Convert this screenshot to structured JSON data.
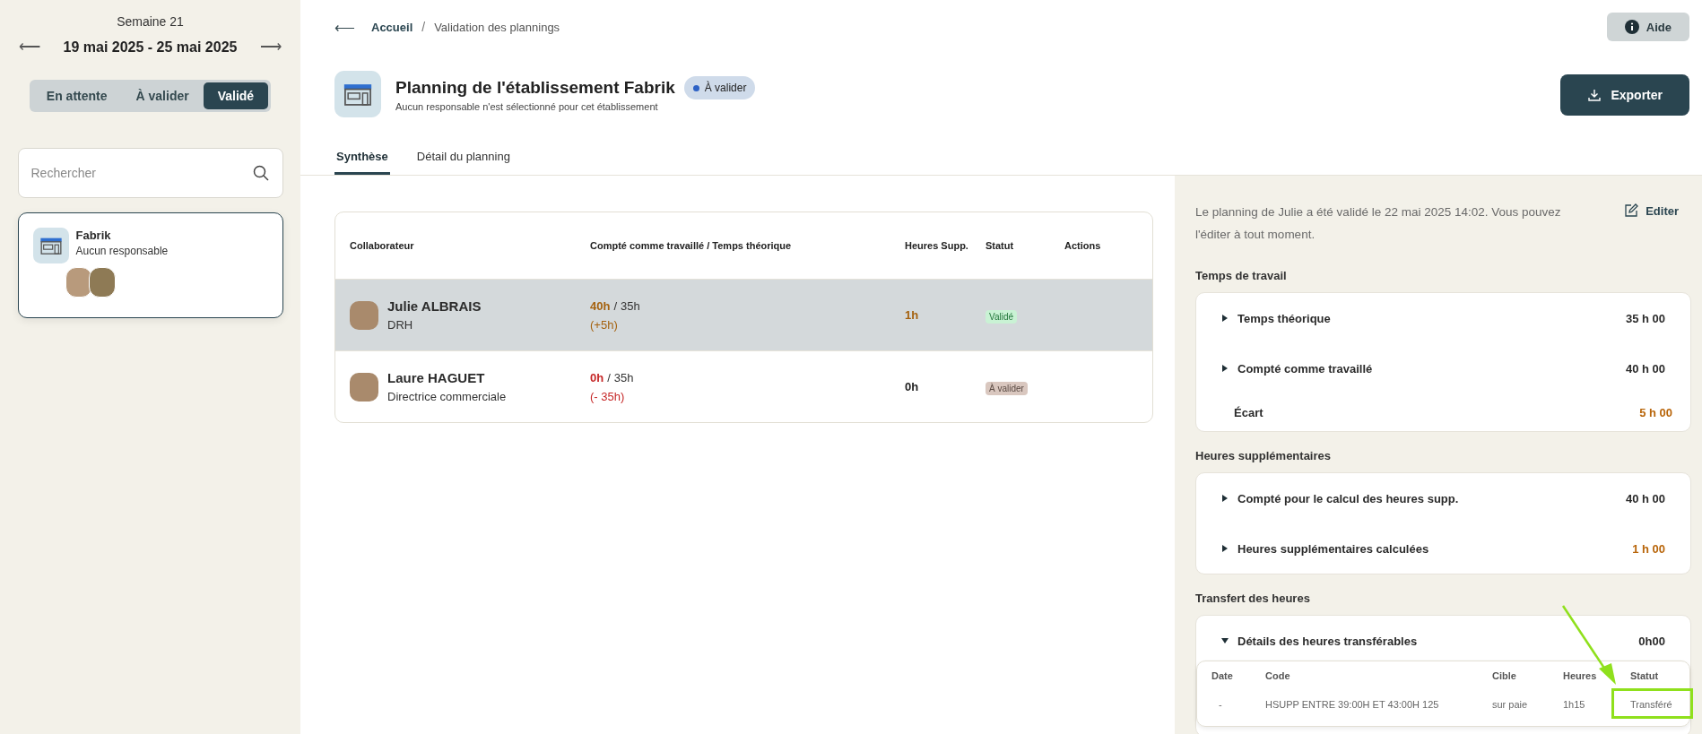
{
  "sidebar": {
    "week_label": "Semaine 21",
    "prev": "⟵",
    "range": "19 mai 2025 - 25 mai 2025",
    "next": "⟶",
    "filters": [
      {
        "label": "En attente",
        "selected": false
      },
      {
        "label": "À valider",
        "selected": false
      },
      {
        "label": "Validé",
        "selected": true
      }
    ],
    "search": {
      "placeholder": "Rechercher"
    },
    "establishments": [
      {
        "name": "Fabrik",
        "subtitle": "Aucun responsable",
        "selected": true
      }
    ]
  },
  "breadcrumb": {
    "back": "⟵",
    "items": [
      "Accueil",
      "Validation des plannings"
    ],
    "separator": "/"
  },
  "help_button": "Aide",
  "header": {
    "title": "Planning de l'établissement Fabrik",
    "subtitle": "Aucun responsable n'est sélectionné pour cet établissement",
    "status_badge": "À valider",
    "export_button": "Exporter"
  },
  "tabs": [
    {
      "label": "Synthèse",
      "selected": true
    },
    {
      "label": "Détail du planning",
      "selected": false
    }
  ],
  "table": {
    "columns": [
      "Collaborateur",
      "Compté comme travaillé / Temps théorique",
      "Heures Supp.",
      "Statut",
      "Actions"
    ],
    "rows": [
      {
        "name": "Julie ALBRAIS",
        "role": "DRH",
        "worked": "40h",
        "theoretical": "35h",
        "separator": "/",
        "delta": "(+5h)",
        "over_target": true,
        "overtime": "1h",
        "status": "Validé",
        "validated": true,
        "selected": true
      },
      {
        "name": "Laure HAGUET",
        "role": "Directrice commerciale",
        "worked": "0h",
        "theoretical": "35h",
        "separator": "/",
        "delta": "(- 35h)",
        "over_target": false,
        "overtime": "0h",
        "status": "À valider",
        "validated": false,
        "selected": false
      }
    ]
  },
  "summary": {
    "message": "Le planning de Julie a été validé le 22 mai 2025 14:02. Vous pouvez l'éditer à tout moment.",
    "edit_button": "Editer",
    "sections": [
      {
        "title": "Temps de travail",
        "rows": [
          {
            "kind": "expandable",
            "expanded": false,
            "label": "Temps théorique",
            "value": "35 h 00",
            "highlighted": false
          },
          {
            "kind": "expandable",
            "expanded": false,
            "label": "Compté comme travaillé",
            "value": "40 h 00",
            "highlighted": false
          },
          {
            "kind": "plain",
            "label": "Écart",
            "value": "5 h 00",
            "highlighted": true
          }
        ]
      },
      {
        "title": "Heures supplémentaires",
        "rows": [
          {
            "kind": "expandable",
            "expanded": false,
            "label": "Compté pour le calcul des heures supp.",
            "value": "40 h 00",
            "highlighted": false
          },
          {
            "kind": "expandable",
            "expanded": false,
            "label": "Heures supplémentaires calculées",
            "value": "1 h 00",
            "highlighted": true
          }
        ]
      },
      {
        "title": "Transfert des heures",
        "rows": [
          {
            "kind": "expandable",
            "expanded": true,
            "label": "Détails des heures transférables",
            "value": "0h00",
            "highlighted": false,
            "detail": {
              "columns": [
                "Date",
                "Code",
                "Cible",
                "Heures",
                "Statut"
              ],
              "rows": [
                [
                  "-",
                  "HSUPP ENTRE 39:00H ET 43:00H 125",
                  "sur paie",
                  "1h15",
                  "Transféré"
                ]
              ]
            }
          }
        ]
      }
    ]
  }
}
